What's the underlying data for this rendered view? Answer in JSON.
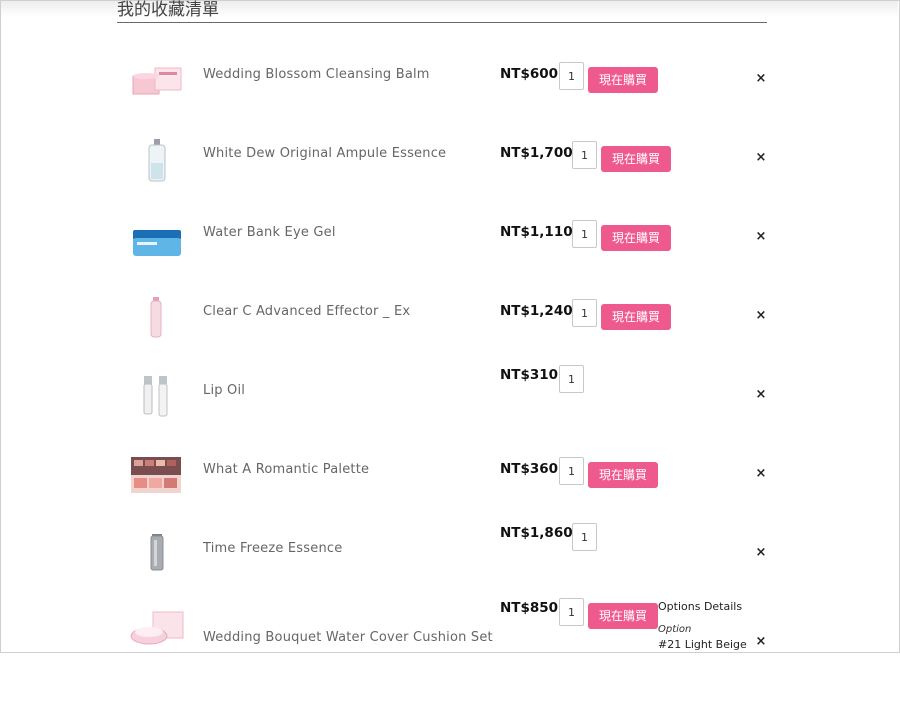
{
  "page": {
    "title": "我的收藏清單"
  },
  "wishlist": {
    "buy_label": "現在購買",
    "remove_symbol": "×",
    "items": [
      {
        "name": "Wedding Blossom Cleansing Balm",
        "price": "NT$600",
        "qty": "1",
        "has_buy": true
      },
      {
        "name": "White Dew Original Ampule Essence",
        "price": "NT$1,700",
        "qty": "1",
        "has_buy": true
      },
      {
        "name": "Water Bank Eye Gel",
        "price": "NT$1,110",
        "qty": "1",
        "has_buy": true
      },
      {
        "name": "Clear C Advanced Effector _ Ex",
        "price": "NT$1,240",
        "qty": "1",
        "has_buy": true
      },
      {
        "name": "Lip Oil",
        "price": "NT$310",
        "qty": "1",
        "has_buy": false
      },
      {
        "name": "What A Romantic Palette",
        "price": "NT$360",
        "qty": "1",
        "has_buy": true
      },
      {
        "name": "Time Freeze Essence",
        "price": "NT$1,860",
        "qty": "1",
        "has_buy": false
      },
      {
        "name": "Wedding Bouquet Water Cover Cushion Set",
        "price": "NT$850",
        "qty": "1",
        "has_buy": true,
        "options": {
          "title": "Options Details",
          "label": "Option",
          "value": "#21 Light Beige"
        }
      }
    ]
  },
  "colors": {
    "buy_button": "#ef5a8e",
    "divider": "#6a6a6a"
  }
}
